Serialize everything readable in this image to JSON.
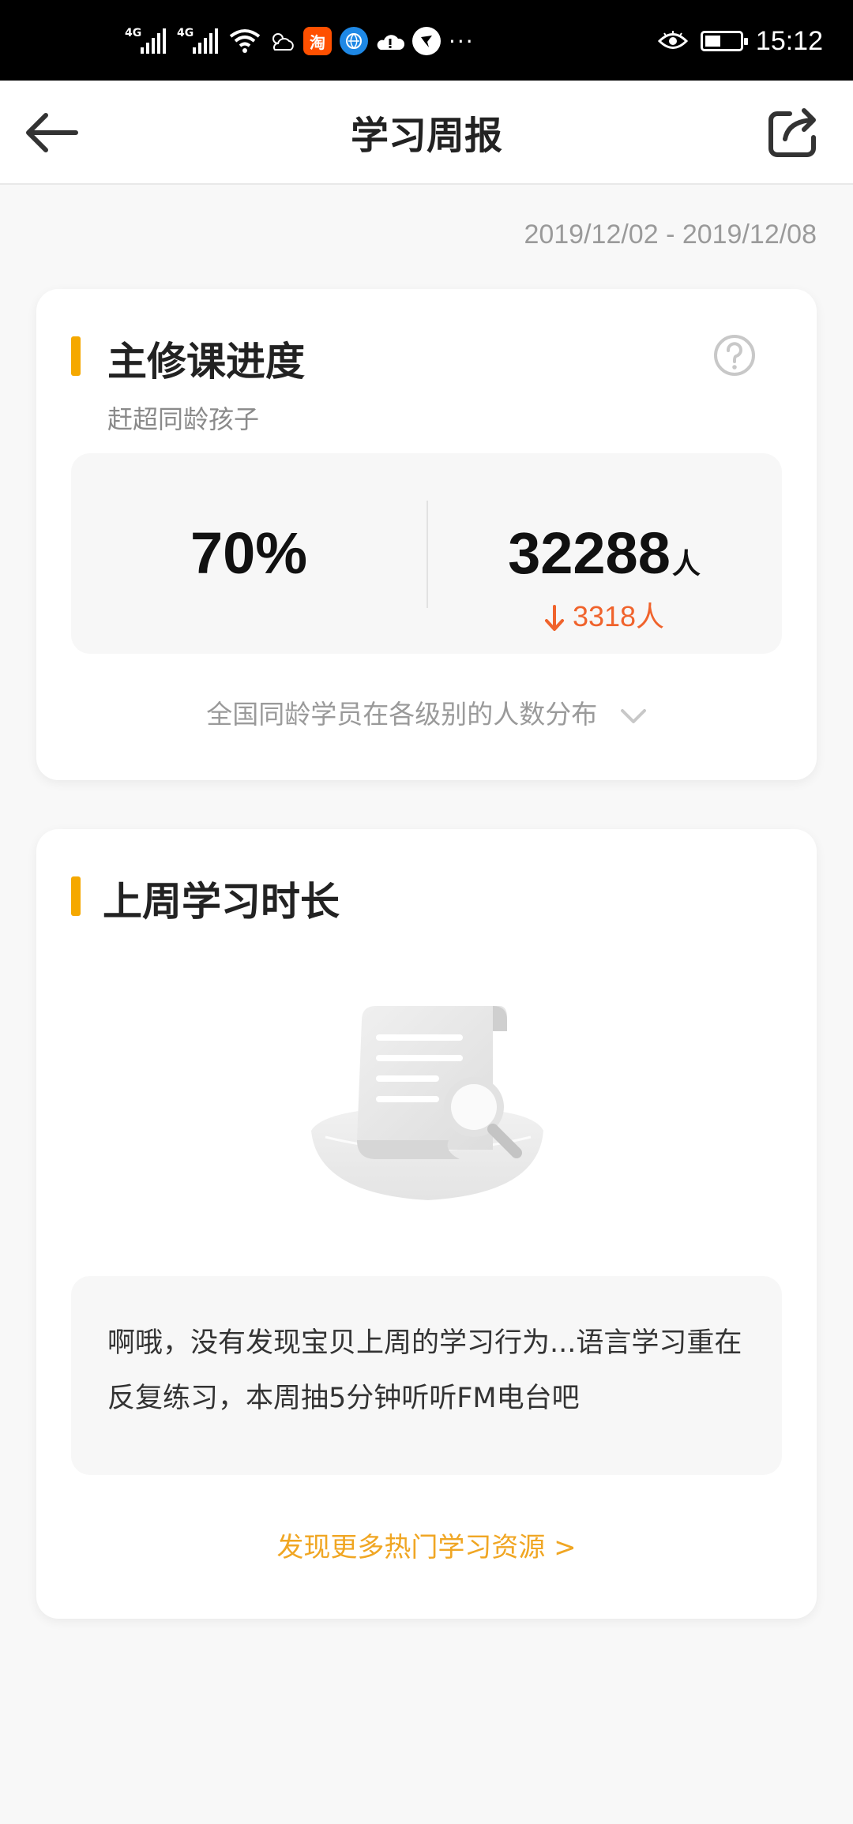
{
  "status_bar": {
    "network1": "4G",
    "network2": "4G",
    "taobao_label": "淘",
    "more": "···",
    "time": "15:12",
    "battery_level": 0.45
  },
  "header": {
    "title": "学习周报",
    "back_icon": "arrow-left-icon",
    "share_icon": "share-icon"
  },
  "date_range": "2019/12/02 - 2019/12/08",
  "progress_card": {
    "title": "主修课进度",
    "subtitle": "赶超同龄孩子",
    "percent": "70%",
    "count": "32288",
    "count_unit": "人",
    "delta": "3318人",
    "delta_direction": "down",
    "distribution_link": "全国同龄学员在各级别的人数分布",
    "accent_color": "#f5a800",
    "delta_color": "#f0632c"
  },
  "study_time_card": {
    "title": "上周学习时长",
    "illustration": "empty-document-search-icon",
    "message": "啊哦，没有发现宝贝上周的学习行为...语言学习重在反复练习，本周抽5分钟听听FM电台吧",
    "more_link": "发现更多热门学习资源 >",
    "link_color": "#f0a623"
  }
}
